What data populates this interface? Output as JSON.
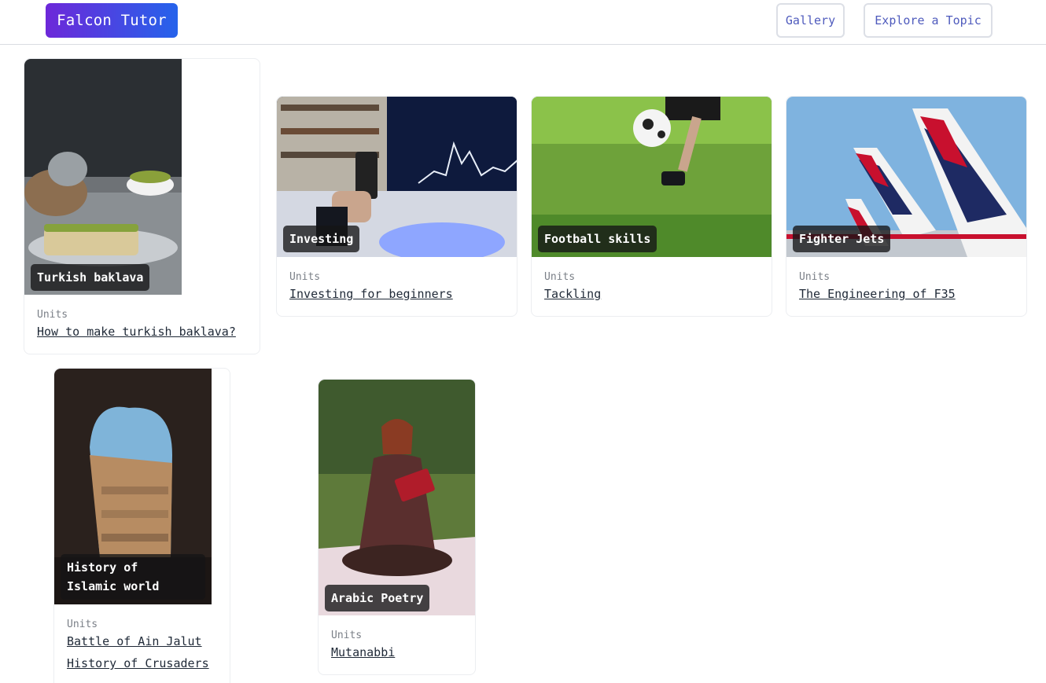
{
  "header": {
    "logo_text": "Falcon Tutor",
    "nav": {
      "gallery_label": "Gallery",
      "explore_label": "Explore a Topic"
    }
  },
  "cards": [
    {
      "tag": "Turkish baklava",
      "units_label": "Units",
      "units": [
        "How to make turkish baklava?"
      ]
    },
    {
      "tag": "Investing",
      "units_label": "Units",
      "units": [
        "Investing for beginners"
      ]
    },
    {
      "tag": "Football skills",
      "units_label": "Units",
      "units": [
        "Tackling"
      ]
    },
    {
      "tag": "Fighter Jets",
      "units_label": "Units",
      "units": [
        "The Engineering of F35"
      ]
    },
    {
      "tag_line1": "History of",
      "tag_line2": "Islamic world",
      "units_label": "Units",
      "units": [
        "Battle of Ain Jalut",
        "History of Crusaders"
      ]
    },
    {
      "tag": "Arabic Poetry",
      "units_label": "Units",
      "units": [
        "Mutanabbi"
      ]
    }
  ],
  "colors": {
    "brand_start": "#6d28d9",
    "brand_end": "#2563eb",
    "nav_text": "#4f5bbd"
  }
}
